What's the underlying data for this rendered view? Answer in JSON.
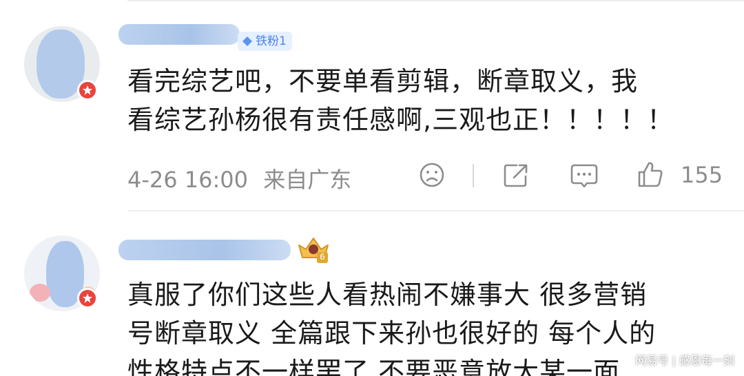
{
  "comments": [
    {
      "fan_badge": "铁粉1",
      "text": "看完综艺吧，不要单看剪辑，断章取义，我\n看综艺孙杨很有责任感啊,三观也正！！！！！",
      "timestamp": "4-26 16:00",
      "location": "来自广东",
      "like_count": "155",
      "icons": {
        "dislike": "sad-face-icon",
        "share": "share-icon",
        "reply": "comment-icon",
        "like": "thumbs-up-icon"
      }
    },
    {
      "level_badge": "6",
      "text": "真服了你们这些人看热闹不嫌事大 很多营销\n号断章取义 全篇跟下来孙也很好的 每个人的\n性格特点不一样罢了 不要恶意放大某一面"
    }
  ],
  "watermark": "网易号 | 感恩每一刻",
  "colors": {
    "accent_blue": "#4c84e8",
    "meta_gray": "#8c8c8c",
    "badge_red": "#e8453c",
    "gold": "#e3a72f"
  }
}
